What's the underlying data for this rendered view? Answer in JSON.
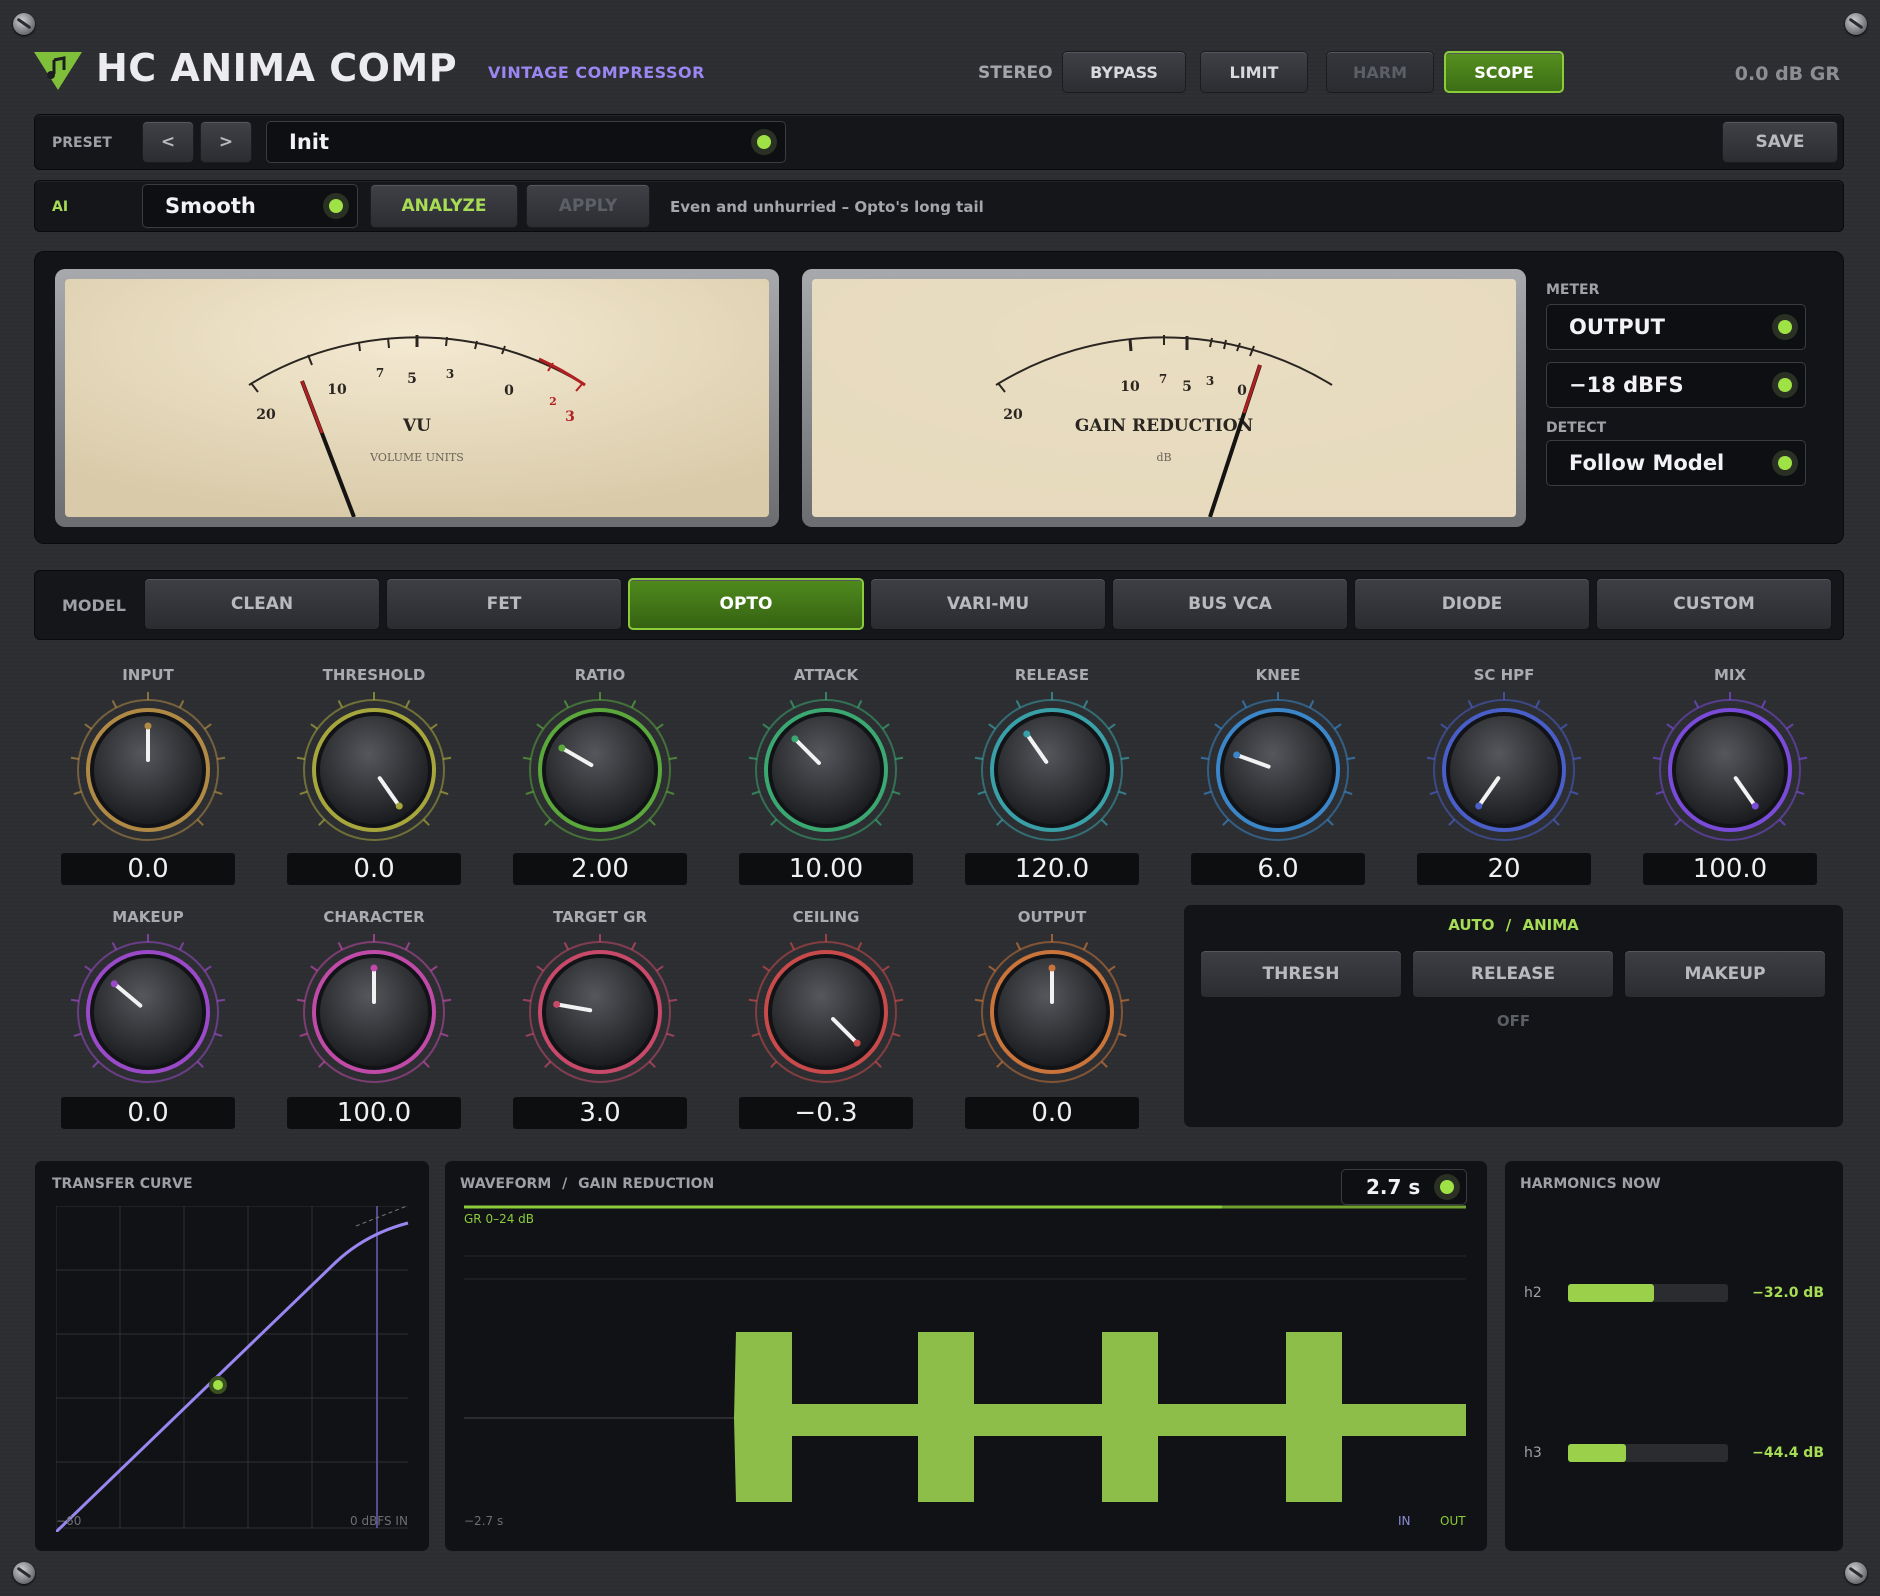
{
  "header": {
    "title": "HC ANIMA COMP",
    "subtitle": "VINTAGE COMPRESSOR",
    "stereo": "STEREO",
    "buttons": [
      "BYPASS",
      "LIMIT",
      "HARM",
      "SCOPE"
    ],
    "gr_readout": "0.0 dB GR"
  },
  "preset": {
    "label": "PRESET",
    "prev": "<",
    "next": ">",
    "name": "Init",
    "save": "SAVE"
  },
  "ai": {
    "label": "AI",
    "mode": "Smooth",
    "analyze": "ANALYZE",
    "apply": "APPLY",
    "description": "Even and unhurried – Opto's long tail"
  },
  "vu_meter": {
    "scale": [
      "20",
      "10",
      "7",
      "5",
      "3",
      "0",
      "2",
      "3"
    ],
    "title": "VU",
    "subtitle": "VOLUME UNITS"
  },
  "gr_meter": {
    "scale": [
      "20",
      "10",
      "7",
      "5",
      "3",
      "0"
    ],
    "title": "GAIN REDUCTION",
    "subtitle": "dB"
  },
  "meter_side": {
    "meter_label": "METER",
    "meter_value": "OUTPUT",
    "ref_value": "−18 dBFS",
    "detect_label": "DETECT",
    "detect_value": "Follow Model"
  },
  "model": {
    "label": "MODEL",
    "options": [
      "CLEAN",
      "FET",
      "OPTO",
      "VARI-MU",
      "BUS VCA",
      "DIODE",
      "CUSTOM"
    ],
    "selected": "OPTO"
  },
  "knobs_row1": [
    {
      "label": "INPUT",
      "value": "0.0",
      "color": "#b08a45"
    },
    {
      "label": "THRESHOLD",
      "value": "0.0",
      "color": "#a6a63c"
    },
    {
      "label": "RATIO",
      "value": "2.00",
      "color": "#5aa83c"
    },
    {
      "label": "ATTACK",
      "value": "10.00",
      "color": "#3aa870"
    },
    {
      "label": "RELEASE",
      "value": "120.0",
      "color": "#3aa0a8"
    },
    {
      "label": "KNEE",
      "value": "6.0",
      "color": "#3a86c8"
    },
    {
      "label": "SC HPF",
      "value": "20",
      "color": "#4a5ec8"
    },
    {
      "label": "MIX",
      "value": "100.0",
      "color": "#7a4ad8"
    }
  ],
  "knobs_row2": [
    {
      "label": "MAKEUP",
      "value": "0.0",
      "color": "#9a4ac8"
    },
    {
      "label": "CHARACTER",
      "value": "100.0",
      "color": "#c04aa8"
    },
    {
      "label": "TARGET GR",
      "value": "3.0",
      "color": "#c84a6a"
    },
    {
      "label": "CEILING",
      "value": "−0.3",
      "color": "#c84a4a"
    },
    {
      "label": "OUTPUT",
      "value": "0.0",
      "color": "#c8743a"
    }
  ],
  "auto": {
    "title_a": "AUTO",
    "sep": "/",
    "title_b": "ANIMA",
    "buttons": [
      "THRESH",
      "RELEASE",
      "MAKEUP"
    ],
    "status": "OFF"
  },
  "transfer": {
    "title": "TRANSFER CURVE",
    "xmin_label": "−60",
    "xmax_label": "0 dBFS IN"
  },
  "waveform": {
    "title_a": "WAVEFORM",
    "sep": "/",
    "title_b": "GAIN REDUCTION",
    "window": "2.7 s",
    "gr_label": "GR 0–24 dB",
    "time_label": "−2.7 s",
    "in_label": "IN",
    "out_label": "OUT"
  },
  "harmonics": {
    "title": "HARMONICS NOW",
    "items": [
      {
        "name": "h2",
        "value": "−32.0 dB",
        "level": 0.54
      },
      {
        "name": "h3",
        "value": "−44.4 dB",
        "level": 0.36
      }
    ]
  },
  "colors": {
    "accent": "#8acc3a",
    "purple": "#9b86f2",
    "curve": "#9a86f0"
  }
}
